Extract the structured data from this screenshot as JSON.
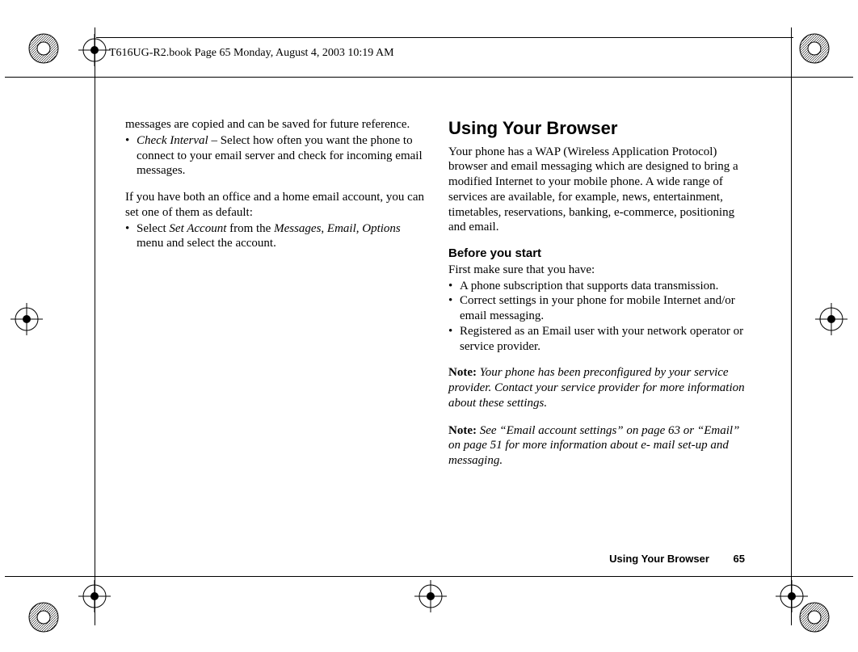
{
  "header": {
    "running": "T616UG-R2.book  Page 65  Monday, August 4, 2003  10:19 AM"
  },
  "left": {
    "continuation": "messages are copied and can be saved for future reference.",
    "bullet1_lead": "Check Interval",
    "bullet1_rest": " – Select how often you want the phone to connect to your email server and check for incoming email messages.",
    "para2": "If you have both an office and a home email account, you can set one of them as default:",
    "bullet2_pre": "Select ",
    "bullet2_i1": "Set Account",
    "bullet2_mid1": " from the ",
    "bullet2_i2": "Messages",
    "bullet2_sep1": ", ",
    "bullet2_i3": "Email",
    "bullet2_sep2": ", ",
    "bullet2_i4": "Options",
    "bullet2_post": " menu and select the account."
  },
  "right": {
    "title": "Using Your Browser",
    "intro": "Your phone has a WAP (Wireless Application Protocol) browser and email messaging which are designed to bring a modified Internet to your mobile phone. A wide range of services are available, for example, news, entertainment, timetables, reservations, banking, e-commerce, positioning and email.",
    "before_h": "Before you start",
    "before_p": "First make sure that you have:",
    "b1": "A phone subscription that supports data transmission.",
    "b2": "Correct settings in your phone for mobile Internet and/or email messaging.",
    "b3": "Registered as an Email user with your network operator or service provider.",
    "note1_label": "Note:",
    "note1_body": " Your phone has been preconfigured by your service provider. Contact your service provider for more information about these settings.",
    "note2_label": "Note:",
    "note2_body": " See “Email account settings” on page 63 or “Email” on page 51 for more information about e- mail set-up and messaging."
  },
  "footer": {
    "section": "Using Your Browser",
    "page": "65"
  }
}
